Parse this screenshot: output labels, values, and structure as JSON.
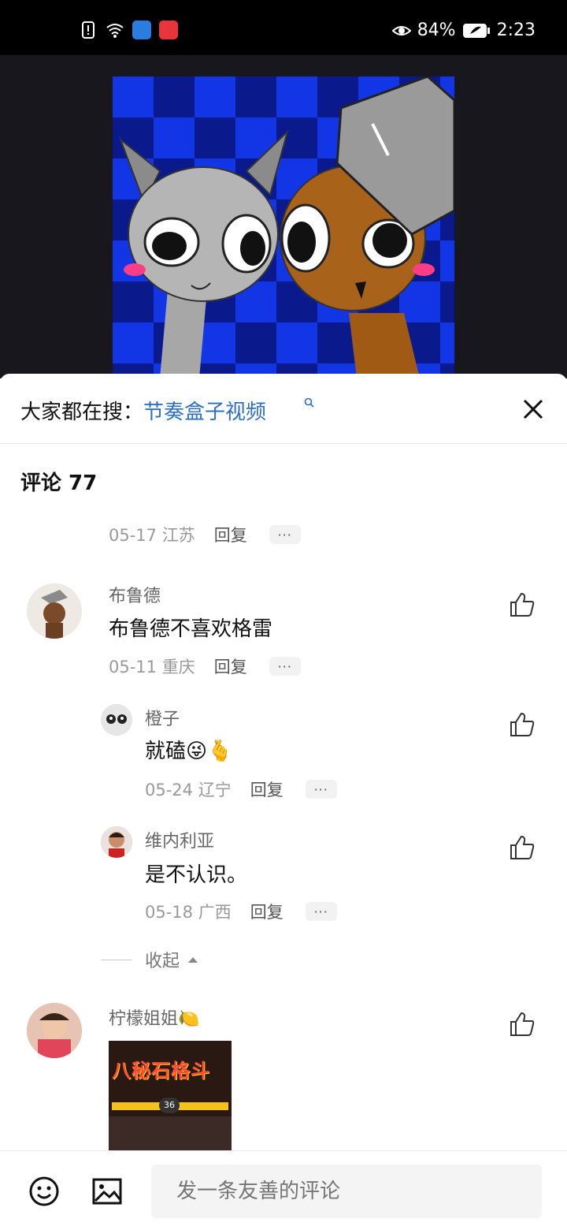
{
  "status_bar": {
    "battery": "84%",
    "time": "2:23",
    "icons": [
      "sim-alert-icon",
      "wifi-icon",
      "browser-app-icon",
      "red-app-icon",
      "eye-icon",
      "battery-icon"
    ]
  },
  "search_suggestion": {
    "label": "大家都在搜：",
    "link": "节奏盒子视频",
    "close_icon": "close-icon"
  },
  "comments": {
    "title": "评论 77",
    "prev_meta": {
      "date_loc": "05-17 江苏",
      "reply": "回复",
      "more": "···"
    },
    "items": [
      {
        "user": "布鲁德",
        "text": "布鲁德不喜欢格雷",
        "date_loc": "05-11 重庆",
        "reply": "回复",
        "more": "···",
        "replies": [
          {
            "user": "橙子",
            "text": "就磕😜🫰",
            "date_loc": "05-24 辽宁",
            "reply": "回复",
            "more": "···"
          },
          {
            "user": "维内利亚",
            "text": "是不认识。",
            "date_loc": "05-18 广西",
            "reply": "回复",
            "more": "···"
          }
        ]
      },
      {
        "user": "柠檬姐姐🍋",
        "image_text": "八秘石格斗",
        "image_counter": "36"
      }
    ],
    "collapse": "收起"
  },
  "input": {
    "placeholder": "发一条友善的评论"
  },
  "colors": {
    "link": "#2e6fbf",
    "video_bg": "#18171d",
    "checker_blue": "#0a2fd8"
  }
}
